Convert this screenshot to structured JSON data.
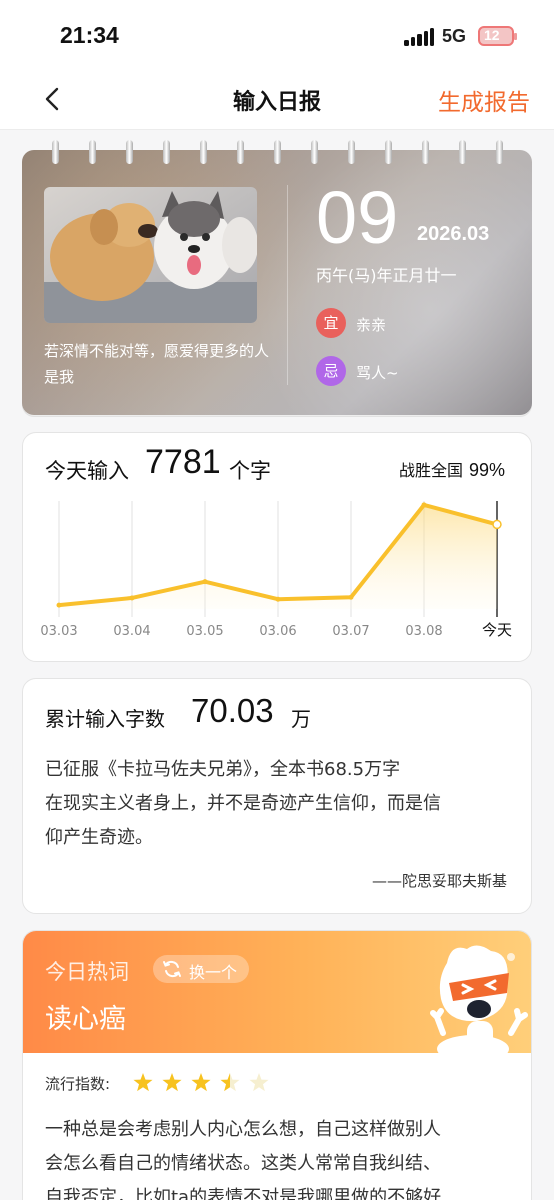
{
  "status": {
    "time": "21:34",
    "network": "5G",
    "battery": "12"
  },
  "nav": {
    "title": "输入日报",
    "action": "生成报告"
  },
  "calendar": {
    "quote": "若深情不能对等，愿爱得更多的人是我",
    "day": "09",
    "year_month": "2026.03",
    "lunar": "丙午(马)年正月廿一",
    "good": {
      "tag": "宜",
      "text": "亲亲",
      "color": "#e9615c"
    },
    "bad": {
      "tag": "忌",
      "text": "骂人~",
      "color": "#b067e8"
    }
  },
  "today": {
    "label": "今天输入",
    "count": "7781",
    "unit": "个字",
    "beat_label": "战胜全国",
    "beat_value": "99%"
  },
  "chart_data": {
    "type": "area",
    "categories": [
      "03.03",
      "03.04",
      "03.05",
      "03.06",
      "03.07",
      "03.08",
      "今天"
    ],
    "values": [
      300,
      850,
      2100,
      750,
      900,
      8000,
      6500
    ],
    "ylim": [
      0,
      8300
    ],
    "color": "#f9c02c"
  },
  "cumulative": {
    "label": "累计输入字数",
    "value": "70.03",
    "unit": "万",
    "line1": "已征服《卡拉马佐夫兄弟》，全本书68.5万字",
    "line2": "在现实主义者身上，并不是奇迹产生信仰，而是信",
    "line3": "仰产生奇迹。",
    "author": "——陀思妥耶夫斯基"
  },
  "hot": {
    "label": "今日热词",
    "swap": "换一个",
    "word": "读心癌",
    "popularity_label": "流行指数:",
    "rating": 3.5,
    "rating_max": 5,
    "line1": "一种总是会考虑别人内心怎么想，自己这样做别人",
    "line2": "会怎么看自己的情绪状态。这类人常常自我纠结、",
    "line3": "自我否定，比如ta的表情不对是我哪里做的不够好"
  }
}
